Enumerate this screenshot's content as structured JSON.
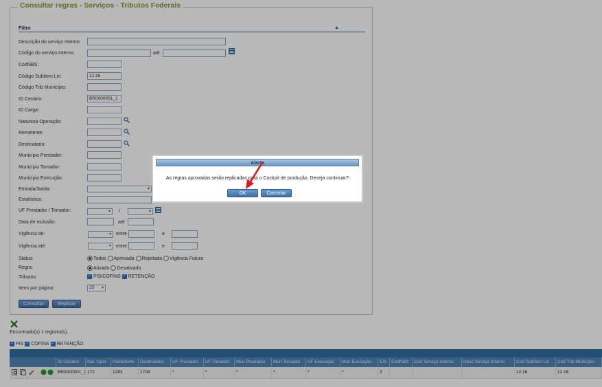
{
  "page": {
    "title": "Consultar regras - Serviços - Tributos Federais",
    "filter_header": "Filtro",
    "collapse_glyph": "▲"
  },
  "form": {
    "descricao_label": "Descrição do serviço Interno:",
    "codigo_label": "Código do serviço Interno:",
    "ate": "até",
    "codnbs_label": "CodNBS:",
    "subitem_label": "Código Subitem Lei:",
    "subitem_value": "12.16",
    "trib_label": "Código Trib Município:",
    "cenario_label": "ID Cenário:",
    "cenario_value": "BR0000001_1",
    "carga_label": "ID Carga:",
    "natureza_label": "Natureza Operação:",
    "remetente_label": "Remetente:",
    "destinatario_label": "Destinatario:",
    "mun_prestador_label": "Município Prestador:",
    "mun_tomador_label": "Município Tomador:",
    "mun_execucao_label": "Município Execução:",
    "entrada_label": "Entrada/Saída:",
    "estatistica_label": "Estatística:",
    "uf_label": "UF Prestador / Tomador:",
    "uf_sep": "/",
    "inclusao_label": "Data de inclusão:",
    "vig_de_label": "Vigência de:",
    "vig_ate_label": "Vigência até:",
    "entre": "entre",
    "e": "e",
    "status_label": "Status:",
    "status_options": [
      "Todos",
      "Aprovada",
      "Rejeitada",
      "Vigência Futura"
    ],
    "regra_label": "Regra:",
    "regra_options": [
      "Ativado",
      "Desativado"
    ],
    "tributos_label": "Tributos:",
    "tributo_pis": "PIS/COFINS",
    "tributo_ret": "RETENÇÃO",
    "itens_label": "Itens por página:",
    "itens_value": "25",
    "consultar_button": "Consultar",
    "replicar_button": "Replicar"
  },
  "results": {
    "found_text": "Encontrado(s) 1 registro(s).",
    "filter_pis": "PIS",
    "filter_cofins": "COFINS",
    "filter_ret": "RETENÇÃO",
    "columns": [
      "ID Cenário",
      "Nat. Oper",
      "Remetente",
      "Destinatário",
      "UF Prestador",
      "UF Tomador",
      "Mun Prestador",
      "Mun Tomador",
      "UF Execução",
      "Mun Execução",
      "E/S",
      "CodNBS",
      "Cod Serviço Interno",
      "Desc Serviço Interno",
      "Cod Subitem Lei",
      "Cod Trib Município"
    ],
    "row": [
      "BR0000001_1",
      "172",
      "1283",
      "1708",
      "*",
      "*",
      "*",
      "*",
      "*",
      "*",
      "3",
      "",
      "",
      "",
      "12.16",
      "12.16"
    ]
  },
  "dialog": {
    "title": "Alerta",
    "message": "As regras aprovadas serão replicadas para o Cockpit de produção. Deseja continuar?",
    "ok_button": "OK",
    "cancel_button": "Cancelar",
    "arrow_color": "#e0161b"
  }
}
